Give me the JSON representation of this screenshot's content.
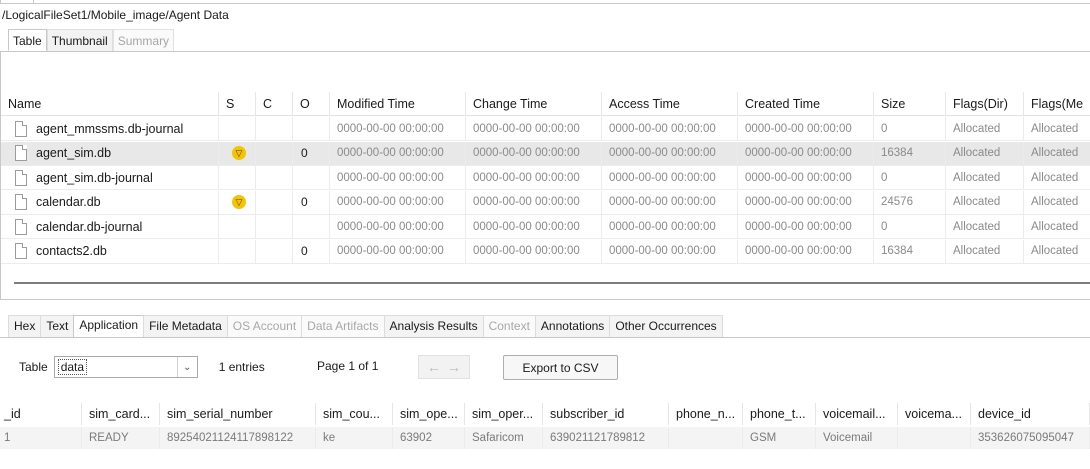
{
  "breadcrumb": "/LogicalFileSet1/Mobile_image/Agent Data",
  "view_tabs": [
    {
      "label": "Table"
    },
    {
      "label": "Thumbnail"
    },
    {
      "label": "Summary"
    }
  ],
  "file_table": {
    "columns": [
      "Name",
      "S",
      "C",
      "O",
      "Modified Time",
      "Change Time",
      "Access Time",
      "Created Time",
      "Size",
      "Flags(Dir)",
      "Flags(Me"
    ],
    "rows": [
      {
        "name": "agent_mmssms.db-journal",
        "s": "",
        "c": "",
        "o": "",
        "modified": "0000-00-00 00:00:00",
        "change": "0000-00-00 00:00:00",
        "access": "0000-00-00 00:00:00",
        "created": "0000-00-00 00:00:00",
        "size": "0",
        "flags_dir": "Allocated",
        "flags_meta": "Allocated"
      },
      {
        "name": "agent_sim.db",
        "s": "score",
        "c": "",
        "o": "0",
        "modified": "0000-00-00 00:00:00",
        "change": "0000-00-00 00:00:00",
        "access": "0000-00-00 00:00:00",
        "created": "0000-00-00 00:00:00",
        "size": "16384",
        "flags_dir": "Allocated",
        "flags_meta": "Allocated",
        "selected": true
      },
      {
        "name": "agent_sim.db-journal",
        "s": "",
        "c": "",
        "o": "",
        "modified": "0000-00-00 00:00:00",
        "change": "0000-00-00 00:00:00",
        "access": "0000-00-00 00:00:00",
        "created": "0000-00-00 00:00:00",
        "size": "0",
        "flags_dir": "Allocated",
        "flags_meta": "Allocated"
      },
      {
        "name": "calendar.db",
        "s": "score",
        "c": "",
        "o": "0",
        "modified": "0000-00-00 00:00:00",
        "change": "0000-00-00 00:00:00",
        "access": "0000-00-00 00:00:00",
        "created": "0000-00-00 00:00:00",
        "size": "24576",
        "flags_dir": "Allocated",
        "flags_meta": "Allocated"
      },
      {
        "name": "calendar.db-journal",
        "s": "",
        "c": "",
        "o": "",
        "modified": "0000-00-00 00:00:00",
        "change": "0000-00-00 00:00:00",
        "access": "0000-00-00 00:00:00",
        "created": "0000-00-00 00:00:00",
        "size": "0",
        "flags_dir": "Allocated",
        "flags_meta": "Allocated"
      },
      {
        "name": "contacts2.db",
        "s": "",
        "c": "",
        "o": "0",
        "modified": "0000-00-00 00:00:00",
        "change": "0000-00-00 00:00:00",
        "access": "0000-00-00 00:00:00",
        "created": "0000-00-00 00:00:00",
        "size": "16384",
        "flags_dir": "Allocated",
        "flags_meta": "Allocated"
      }
    ]
  },
  "content_tabs": [
    {
      "label": "Hex",
      "state": "normal"
    },
    {
      "label": "Text",
      "state": "normal"
    },
    {
      "label": "Application",
      "state": "active"
    },
    {
      "label": "File Metadata",
      "state": "normal"
    },
    {
      "label": "OS Account",
      "state": "disabled"
    },
    {
      "label": "Data Artifacts",
      "state": "disabled"
    },
    {
      "label": "Analysis Results",
      "state": "normal"
    },
    {
      "label": "Context",
      "state": "disabled"
    },
    {
      "label": "Annotations",
      "state": "normal"
    },
    {
      "label": "Other Occurrences",
      "state": "normal"
    }
  ],
  "toolbar": {
    "table_label": "Table",
    "table_value": "data",
    "entries": "1 entries",
    "page": "Page  1  of  1",
    "prev_icon": "arrow-left-icon",
    "next_icon": "arrow-right-icon",
    "export_label": "Export to CSV"
  },
  "data_table": {
    "columns": [
      "_id",
      "sim_card...",
      "sim_serial_number",
      "sim_cou...",
      "sim_ope...",
      "sim_oper...",
      "subscriber_id",
      "phone_n...",
      "phone_t...",
      "voicemail...",
      "voicema...",
      "device_id"
    ],
    "rows": [
      [
        "1",
        "READY",
        "89254021124117898122",
        "ke",
        "63902",
        "Safaricom",
        "639021121789812",
        "",
        "GSM",
        "Voicemail",
        "",
        "353626075095047"
      ]
    ]
  },
  "colors": {
    "score_badge": "#f5c400",
    "selected_row": "#e8e8e8"
  }
}
